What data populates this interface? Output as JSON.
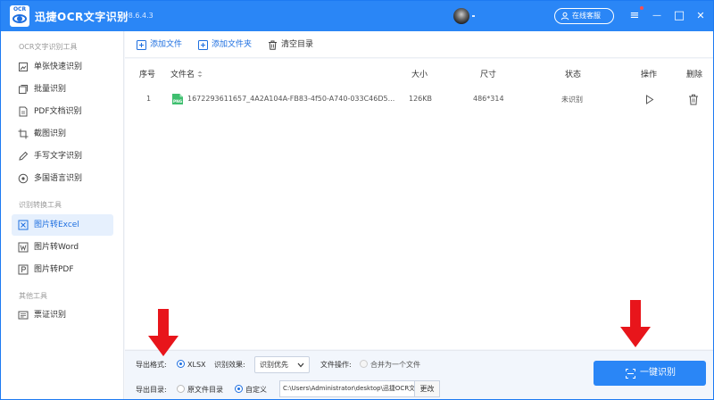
{
  "app": {
    "logo_text": "OCR",
    "title": "迅捷OCR文字识别",
    "version": "v8.6.4.3",
    "service_label": "在线客服",
    "window_controls": {
      "menu": "≡",
      "minimize": "—",
      "maximize": "□",
      "close": "✕"
    }
  },
  "sidebar": {
    "sections": [
      {
        "title": "OCR文字识别工具",
        "items": [
          "单张快速识别",
          "批量识别",
          "PDF文档识别",
          "截图识别",
          "手写文字识别",
          "多国语言识别"
        ]
      },
      {
        "title": "识别转换工具",
        "items": [
          "图片转Excel",
          "图片转Word",
          "图片转PDF"
        ]
      },
      {
        "title": "其他工具",
        "items": [
          "票证识别"
        ]
      }
    ],
    "active_item": "图片转Excel"
  },
  "toolbar": {
    "add_file": "添加文件",
    "add_folder": "添加文件夹",
    "clear_list": "清空目录"
  },
  "table": {
    "headers": {
      "index": "序号",
      "filename": "文件名",
      "size": "大小",
      "dimensions": "尺寸",
      "status": "状态",
      "action": "操作",
      "delete": "删除"
    },
    "rows": [
      {
        "index": "1",
        "file_type": "PNG",
        "filename": "1672293611657_4A2A104A-FB83-4f50-A740-033C46D5...",
        "size": "126KB",
        "dimensions": "486*314",
        "status": "未识别"
      }
    ]
  },
  "options": {
    "format_label": "导出格式:",
    "format_value": "XLSX",
    "effect_label": "识别效果:",
    "effect_value": "识别优先",
    "file_op_label": "文件操作:",
    "merge_label": "合并为一个文件",
    "dir_label": "导出目录:",
    "dir_original": "原文件目录",
    "dir_custom": "自定义",
    "path_value": "C:\\Users\\Administrator\\desktop\\迅捷OCR文",
    "change_label": "更改"
  },
  "start_button": "一键识别",
  "colors": {
    "accent": "#2a86f6",
    "arrow": "#e8151b"
  }
}
